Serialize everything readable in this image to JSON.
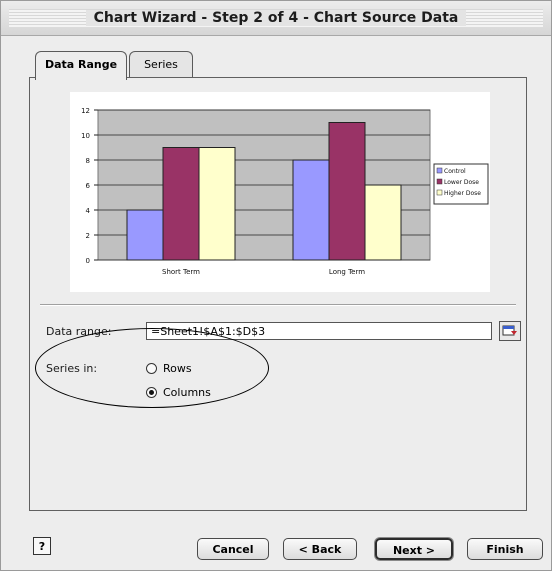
{
  "window": {
    "title": "Chart Wizard - Step 2 of 4 - Chart Source Data"
  },
  "tabs": [
    {
      "label": "Data Range"
    },
    {
      "label": "Series"
    }
  ],
  "form": {
    "data_range_label": "Data range:",
    "data_range_value": "=Sheet1!$A$1:$D$3",
    "series_in_label": "Series in:",
    "options": [
      {
        "label": "Rows",
        "selected": false
      },
      {
        "label": "Columns",
        "selected": true
      }
    ]
  },
  "buttons": {
    "help": "?",
    "cancel": "Cancel",
    "back": "< Back",
    "next": "Next >",
    "finish": "Finish"
  },
  "chart_data": {
    "type": "bar",
    "categories": [
      "Short Term",
      "Long Term"
    ],
    "series": [
      {
        "name": "Control",
        "values": [
          4,
          8
        ],
        "color": "#9999ff"
      },
      {
        "name": "Lower Dose",
        "values": [
          9,
          11
        ],
        "color": "#993366"
      },
      {
        "name": "Higher Dose",
        "values": [
          9,
          6
        ],
        "color": "#ffffcc"
      }
    ],
    "ylim": [
      0,
      12
    ],
    "yticks": [
      0,
      2,
      4,
      6,
      8,
      10,
      12
    ],
    "plot_bg": "#c0c0c0",
    "grid": true,
    "legend_placement": "right"
  },
  "colors": {
    "dialog_bg": "#ededed",
    "annotation_ellipse": "#000000"
  }
}
